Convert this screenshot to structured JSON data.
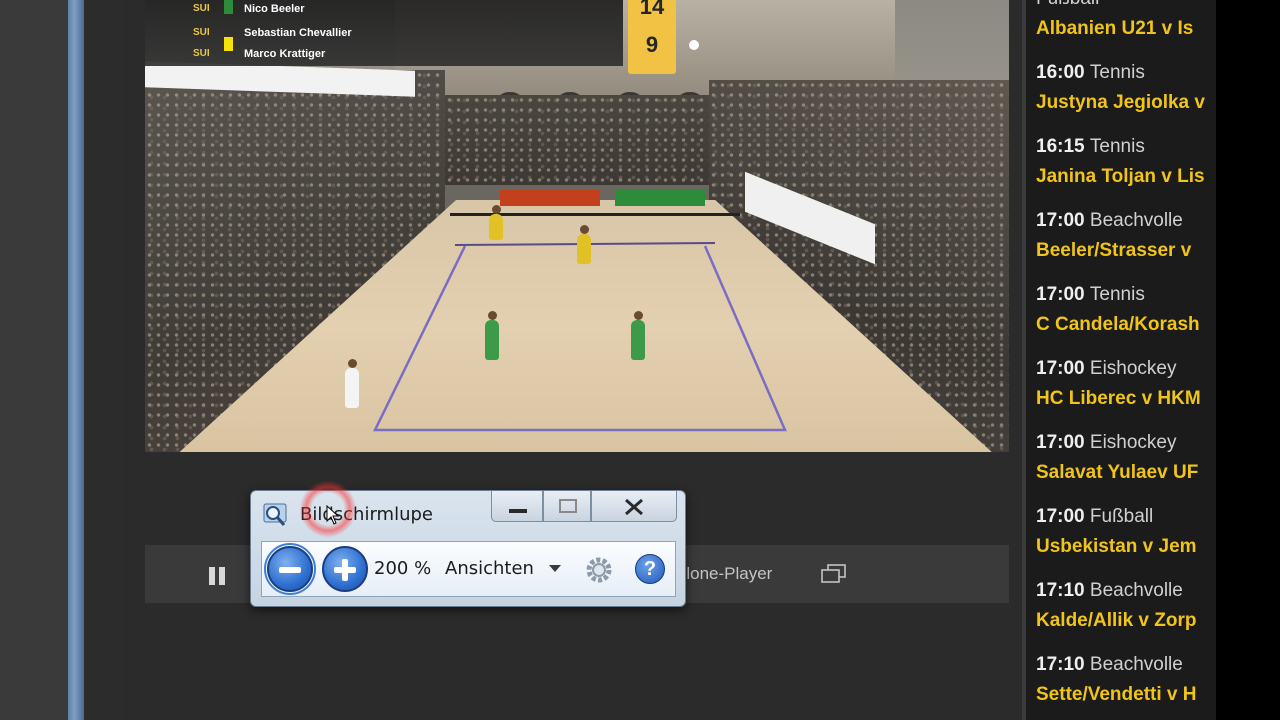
{
  "scoreboard": {
    "players": [
      {
        "country": "SUI",
        "name": "Nico Beeler",
        "flag_color": "#2e8b3a"
      },
      {
        "country": "SUI",
        "name": "Sebastian Chevallier",
        "flag_color": "#2e8b3a"
      },
      {
        "country": "SUI",
        "name": "Marco Krattiger",
        "flag_color": "#f4e20a"
      }
    ],
    "score_top": "14",
    "score_bottom": "9"
  },
  "player_controls": {
    "standalone_label": "Alone-Player"
  },
  "magnifier": {
    "title": "Bildschirmlupe",
    "minimize_label": "—",
    "maximize_label": "☐",
    "close_label": "✕",
    "zoom_level": "200 %",
    "views_label": "Ansichten",
    "help_label": "?"
  },
  "schedule": {
    "items": [
      {
        "time": "",
        "sport": "Fußball",
        "match": "Albanien U21 v Is"
      },
      {
        "time": "16:00",
        "sport": "Tennis",
        "match": "Justyna Jegiolka v"
      },
      {
        "time": "16:15",
        "sport": "Tennis",
        "match": "Janina Toljan v Lis"
      },
      {
        "time": "17:00",
        "sport": "Beachvolle",
        "match": "Beeler/Strasser v"
      },
      {
        "time": "17:00",
        "sport": "Tennis",
        "match": "C Candela/Korash"
      },
      {
        "time": "17:00",
        "sport": "Eishockey",
        "match": "HC Liberec v HKM"
      },
      {
        "time": "17:00",
        "sport": "Eishockey",
        "match": "Salavat Yulaev UF"
      },
      {
        "time": "17:00",
        "sport": "Fußball",
        "match": "Usbekistan v Jem"
      },
      {
        "time": "17:10",
        "sport": "Beachvolle",
        "match": "Kalde/Allik v Zorp"
      },
      {
        "time": "17:10",
        "sport": "Beachvolle",
        "match": "Sette/Vendetti v H"
      }
    ]
  },
  "colors": {
    "accent_yellow": "#f0c419",
    "score_bg": "#f1c243",
    "magnifier_blue": "#2e6fd0"
  }
}
